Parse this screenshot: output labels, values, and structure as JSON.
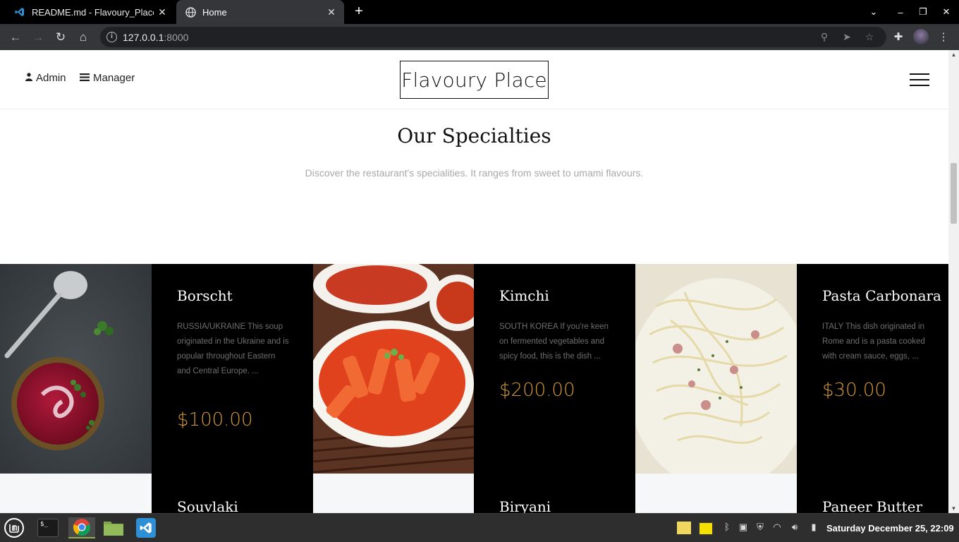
{
  "browser": {
    "tabs": [
      {
        "title": "README.md - Flavoury_Place",
        "icon": "vscode-icon",
        "active": false
      },
      {
        "title": "Home",
        "icon": "globe-icon",
        "active": true
      }
    ],
    "url_host": "127.0.0.1",
    "url_port": ":8000"
  },
  "site": {
    "nav": {
      "admin": "Admin",
      "manager": "Manager"
    },
    "brand": "Flavoury Place",
    "section_title": "Our Specialties",
    "section_subtitle": "Discover the restaurant's specialities. It ranges from sweet to umami flavours.",
    "dishes": [
      {
        "name": "Borscht",
        "desc": "RUSSIA/UKRAINE This soup originated in the Ukraine and is popular throughout Eastern and Central Europe. ...",
        "price": "$100.00",
        "image": "borscht-soup"
      },
      {
        "name": "Kimchi",
        "desc": "SOUTH KOREA If you're keen on fermented vegetables and spicy food, this is the dish ...",
        "price": "$200.00",
        "image": "tteokbokki-kimchi"
      },
      {
        "name": "Pasta Carbonara",
        "desc": "ITALY This dish originated in Rome and is a pasta cooked with cream sauce, eggs, ...",
        "price": "$30.00",
        "image": "carbonara-pasta"
      },
      {
        "name": "Souvlaki"
      },
      {
        "name": "Biryani"
      },
      {
        "name": "Paneer Butter"
      }
    ]
  },
  "taskbar": {
    "clock": "Saturday December 25, 22:09"
  }
}
